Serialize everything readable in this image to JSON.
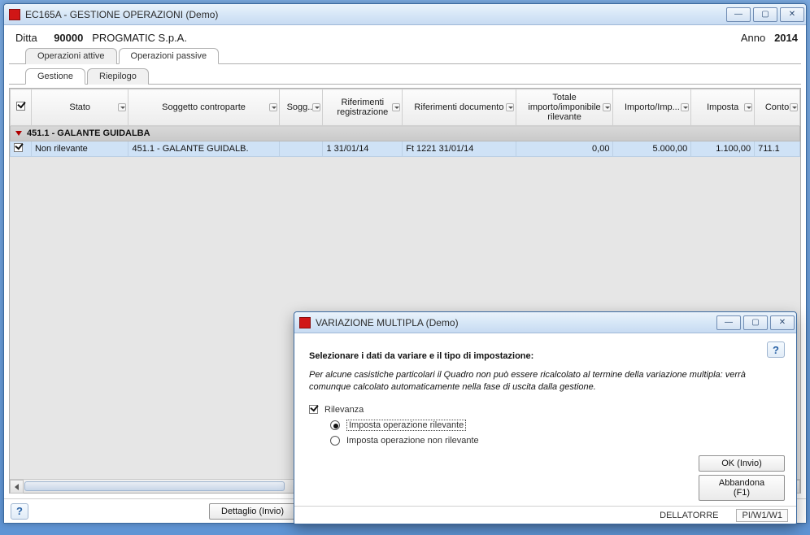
{
  "main": {
    "title": "EC165A - GESTIONE OPERAZIONI  (Demo)",
    "ditta_label": "Ditta",
    "ditta_code": "90000",
    "ditta_name": "PROGMATIC S.p.A.",
    "anno_label": "Anno",
    "anno_value": "2014",
    "tabs_top": {
      "active_idx": 1,
      "items": [
        "Operazioni attive",
        "Operazioni passive"
      ]
    },
    "tabs_sub": {
      "active_idx": 0,
      "items": [
        "Gestione",
        "Riepilogo"
      ]
    },
    "columns": [
      "",
      "Stato",
      "Soggetto controparte",
      "Sogg...",
      "Riferimenti registrazione",
      "Riferimenti documento",
      "Totale importo/imponibile rilevante",
      "Importo/Imp...",
      "Imposta",
      "Conto"
    ],
    "group_label": "451.1 - GALANTE GUIDALBA",
    "row": {
      "checked": true,
      "stato": "Non rilevante",
      "soggetto": "451.1 - GALANTE GUIDALB.",
      "sogg2": "",
      "rif_reg": "1 31/01/14",
      "rif_doc": "Ft 1221 31/01/14",
      "totale": "0,00",
      "importo": "5.000,00",
      "imposta": "1.100,00",
      "conto": "711.1"
    },
    "dettaglio_btn": "Dettaglio (Invio)"
  },
  "dialog": {
    "title": "VARIAZIONE MULTIPLA  (Demo)",
    "heading": "Selezionare i dati da variare e il tipo di impostazione:",
    "note": "Per alcune casistiche particolari il Quadro non può essere ricalcolato al termine della variazione multipla: verrà comunque calcolato automaticamente nella fase di uscita dalla gestione.",
    "check_label": "Rilevanza",
    "check_checked": true,
    "radios": [
      "Imposta operazione rilevante",
      "Imposta operazione non rilevante"
    ],
    "radio_selected": 0,
    "ok_btn": "OK (Invio)",
    "cancel_btn": "Abbandona (F1)",
    "status_user": "DELLATORRE",
    "status_loc": "PI/W1/W1"
  },
  "winbtn": {
    "min": "—",
    "max": "▢",
    "close": "✕"
  }
}
